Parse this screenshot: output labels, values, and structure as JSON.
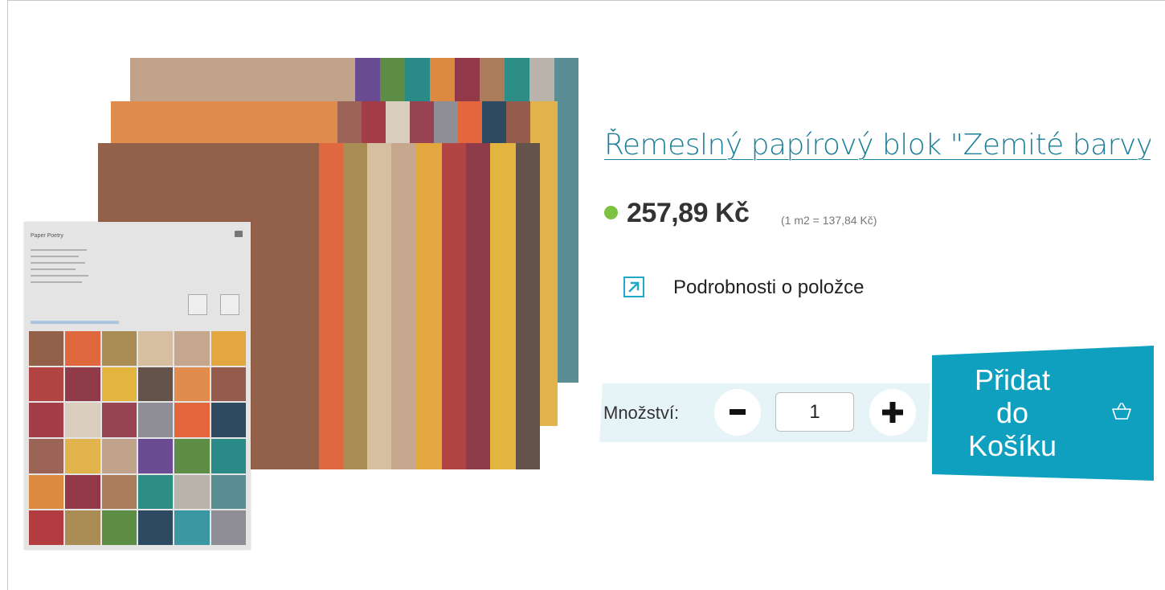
{
  "product": {
    "title": "Řemeslný papírový blok \"Zemité barvy",
    "price": "257,89 Kč",
    "unit_price": "(1 m2 = 137,84 Kč)",
    "in_stock_color": "#7ec242",
    "details_link": "Podrobnosti o položce",
    "image": {
      "pad_brand": "Paper Poetry"
    }
  },
  "quantity": {
    "label": "Množství:",
    "value": "1",
    "decrement_icon": "minus-icon",
    "increment_icon": "plus-icon"
  },
  "cart": {
    "label": "Přidat\ndo\nKošíku",
    "icon": "basket-icon",
    "color": "#0fa0c0"
  },
  "colors": {
    "accent": "#1fa8c8",
    "link": "#1b7f99"
  }
}
